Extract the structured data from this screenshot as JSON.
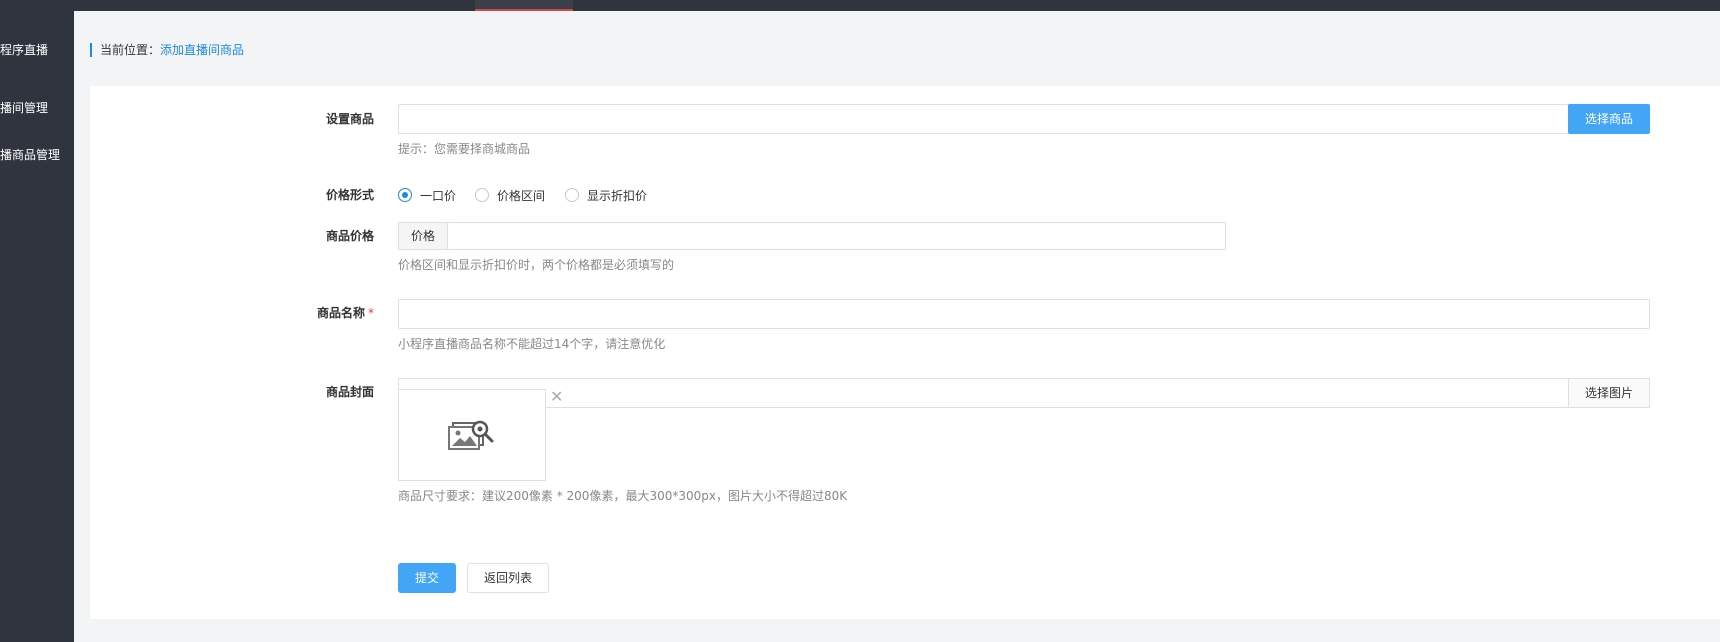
{
  "sidebar": {
    "items": [
      {
        "label": "小程序直播"
      },
      {
        "label": "直播间管理"
      },
      {
        "label": "直播商品管理"
      }
    ]
  },
  "breadcrumb": {
    "prefix": "当前位置：",
    "current": "添加直播间商品"
  },
  "form": {
    "product": {
      "label": "设置商品",
      "value": "",
      "button": "选择商品",
      "help": "提示：您需要择商城商品"
    },
    "price_type": {
      "label": "价格形式",
      "options": [
        "一口价",
        "价格区间",
        "显示折扣价"
      ],
      "selected": "一口价"
    },
    "price": {
      "label": "商品价格",
      "addon": "价格",
      "value": "",
      "help": "价格区间和显示折扣价时，两个价格都是必须填写的"
    },
    "name": {
      "label": "商品名称",
      "required_mark": "*",
      "value": "",
      "help": "小程序直播商品名称不能超过14个字，请注意优化"
    },
    "cover": {
      "label": "商品封面",
      "value": "",
      "button": "选择图片",
      "remove_icon": "close-icon",
      "placeholder_icon": "image-search-icon",
      "help": "商品尺寸要求：建议200像素 * 200像素，最大300*300px，图片大小不得超过80K"
    },
    "actions": {
      "submit": "提交",
      "back": "返回列表"
    }
  },
  "colors": {
    "sidebar_bg": "#2f343e",
    "accent": "#42a5f5",
    "link": "#1e88e5",
    "required": "#e53935"
  }
}
